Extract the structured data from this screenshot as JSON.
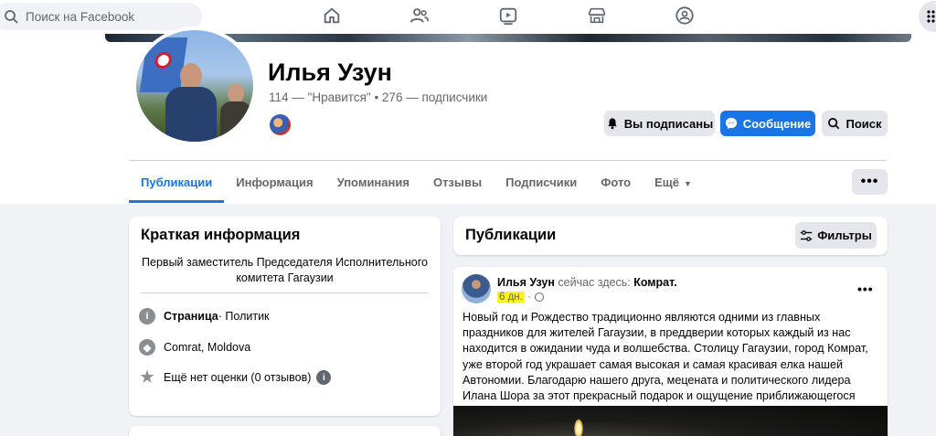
{
  "search": {
    "placeholder": "Поиск на Facebook"
  },
  "nav": {
    "icons": [
      "home-icon",
      "friends-icon",
      "watch-icon",
      "marketplace-icon",
      "groups-icon",
      "menu-grid-icon"
    ]
  },
  "profile": {
    "name": "Илья Узун",
    "likes_count": "114",
    "likes_label": " — \"Нравится\" • ",
    "followers_count": "276",
    "followers_label": " — подписчики"
  },
  "actions": {
    "subscribed_label": "Вы подписаны",
    "message_label": "Сообщение",
    "search_label": "Поиск"
  },
  "tabs": [
    {
      "label": "Публикации",
      "active": true
    },
    {
      "label": "Информация"
    },
    {
      "label": "Упоминания"
    },
    {
      "label": "Отзывы"
    },
    {
      "label": "Подписчики"
    },
    {
      "label": "Фото"
    },
    {
      "label": "Ещё"
    }
  ],
  "more_button": {
    "label": "•••"
  },
  "intro": {
    "title": "Краткая информация",
    "bio": "Первый заместитель Председателя Исполнительного комитета Гагаузии",
    "category_prefix": "Страница",
    "category_value": " · Политик",
    "location": "Comrat, Moldova",
    "rating": "Ещё нет оценки (0 отзывов)"
  },
  "posts": {
    "title": "Публикации",
    "filters_label": "Фильтры",
    "items": [
      {
        "author": "Илья Узун",
        "checkin_text": " сейчас здесь: ",
        "place": "Комрат.",
        "time": "6 дн.",
        "separator": "·",
        "text": "Новый год и Рождество традиционно являются одними из главных праздников для жителей Гагаузии, в преддверии которых каждый из нас находится в ожидании чуда и волшебства. Столицу Гагаузии, город Комрат, уже второй год украшает самая высокая и самая красивая елка нашей Автономии. Благодарю нашего друга, мецената и политического лидера Илана Шора за этот прекрасный подарок и ощущение приближающегося праздника!",
        "menu": "•••"
      }
    ]
  },
  "colors": {
    "accent": "#1b74e4",
    "highlight": "#fbf222",
    "background": "#f0f2f5"
  }
}
